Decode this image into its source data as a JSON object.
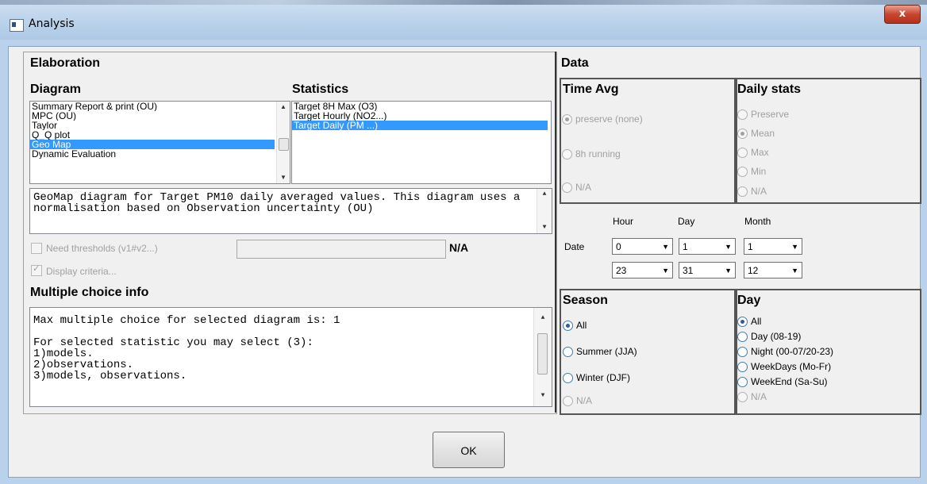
{
  "window": {
    "title": "Analysis",
    "close_label": "x"
  },
  "elaboration": {
    "title": "Elaboration",
    "diagram_label": "Diagram",
    "statistics_label": "Statistics",
    "diagram_items": [
      "Summary Report & print (OU)",
      "MPC (OU)",
      "Taylor",
      "Q_Q plot",
      "Geo Map",
      "Dynamic Evaluation"
    ],
    "diagram_selected": "Geo Map",
    "statistics_items": [
      "Target 8H Max  (O3)",
      "Target Hourly (NO2...)",
      "Target Daily (PM ...)"
    ],
    "statistics_selected": "Target Daily (PM ...)",
    "description": "GeoMap diagram for Target PM10 daily averaged values. This diagram uses a normalisation based on Observation uncertainty (OU)",
    "need_thresholds_label": "Need thresholds (v1#v2...)",
    "threshold_value": "",
    "threshold_na": "N/A",
    "display_criteria_label": "Display criteria...",
    "mci_title": "Multiple choice info",
    "mci_text": "Max multiple choice for selected diagram is: 1\n\nFor selected statistic you may select (3):\n1)models.\n2)observations.\n3)models, observations."
  },
  "data": {
    "title": "Data",
    "time_avg": {
      "title": "Time Avg",
      "options": [
        "preserve (none)",
        "8h running",
        "N/A"
      ],
      "selected": "preserve (none)"
    },
    "daily_stats": {
      "title": "Daily stats",
      "options": [
        "Preserve",
        "Mean",
        "Max",
        "Min",
        "N/A"
      ],
      "selected": "Mean"
    },
    "date": {
      "label": "Date",
      "hour_label": "Hour",
      "day_label": "Day",
      "month_label": "Month",
      "from": {
        "hour": "0",
        "day": "1",
        "month": "1"
      },
      "to": {
        "hour": "23",
        "day": "31",
        "month": "12"
      }
    },
    "season": {
      "title": "Season",
      "options": [
        "All",
        "Summer (JJA)",
        "Winter (DJF)",
        "N/A"
      ],
      "selected": "All"
    },
    "day": {
      "title": "Day",
      "options": [
        "All",
        "Day (08-19)",
        "Night (00-07/20-23)",
        "WeekDays (Mo-Fr)",
        "WeekEnd (Sa-Su)",
        "N/A"
      ],
      "selected": "All"
    }
  },
  "ok_label": "OK"
}
